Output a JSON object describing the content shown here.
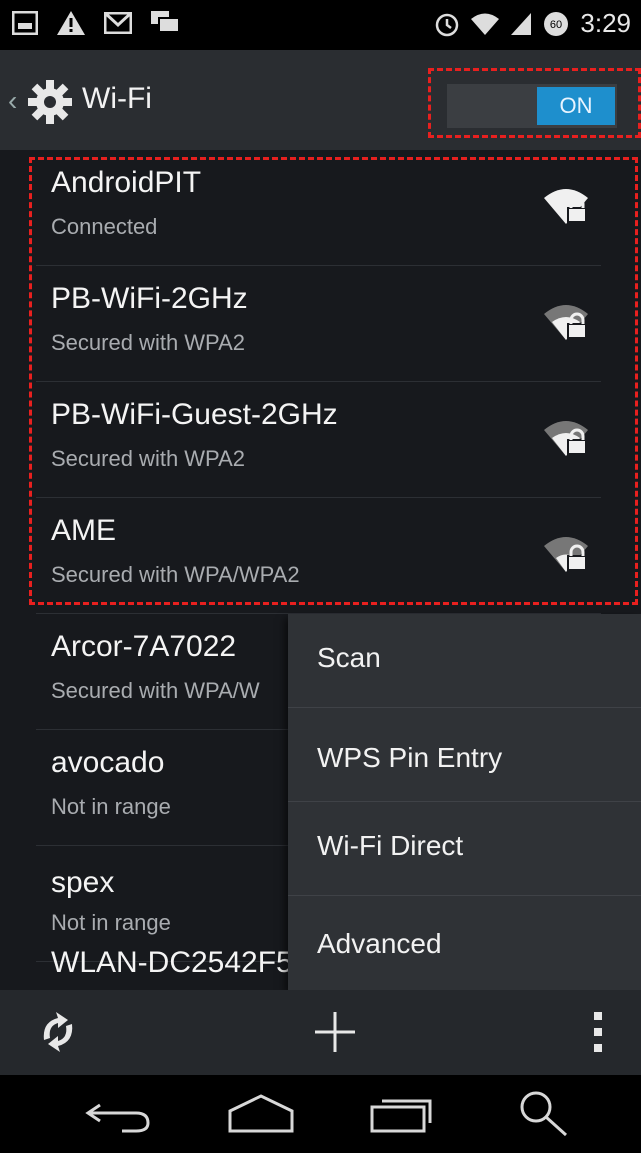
{
  "status_bar": {
    "time": "3:29",
    "left_icons": [
      "gallery-icon",
      "warning-icon",
      "gmail-icon",
      "chat-icon"
    ],
    "right_icons": [
      "alarm-icon",
      "wifi-signal-icon",
      "cell-signal-icon",
      "data-saver-icon"
    ]
  },
  "action_bar": {
    "title": "Wi-Fi",
    "toggle_label": "ON",
    "toggle_color": "#1e8fcd"
  },
  "networks": [
    {
      "name": "AndroidPIT",
      "status": "Connected"
    },
    {
      "name": "PB-WiFi-2GHz",
      "status": "Secured with WPA2"
    },
    {
      "name": "PB-WiFi-Guest-2GHz",
      "status": "Secured with WPA2"
    },
    {
      "name": "AME",
      "status": "Secured with WPA/WPA2"
    },
    {
      "name": "Arcor-7A7022",
      "status": "Secured with WPA/W"
    },
    {
      "name": "avocado",
      "status": "Not in range"
    },
    {
      "name": "spex",
      "status": "Not in range"
    },
    {
      "name": "WLAN-DC2542F5",
      "status": ""
    }
  ],
  "menu": {
    "items": [
      "Scan",
      "WPS Pin Entry",
      "Wi-Fi Direct",
      "Advanced"
    ]
  },
  "toolbar": {
    "icons": [
      "wps-push-icon",
      "add-network-icon",
      "overflow-menu-icon"
    ]
  },
  "nav_bar": {
    "icons": [
      "back-icon",
      "home-icon",
      "recents-icon",
      "search-icon"
    ]
  },
  "annotation_color": "#e8201f"
}
